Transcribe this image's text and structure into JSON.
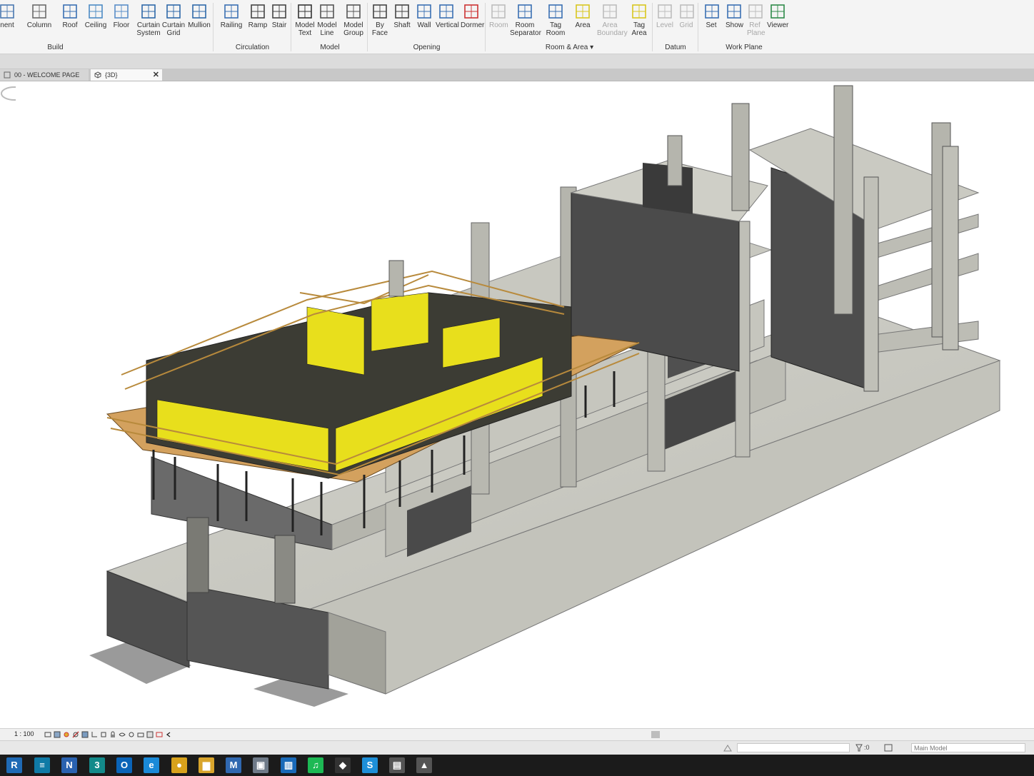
{
  "ribbon": {
    "tools": [
      {
        "id": "component",
        "label": "nent",
        "icon": "component-icon",
        "enabled": true
      },
      {
        "id": "column",
        "label": "Column",
        "icon": "column-icon",
        "enabled": true
      },
      {
        "id": "roof",
        "label": "Roof",
        "icon": "roof-icon",
        "enabled": true
      },
      {
        "id": "ceiling",
        "label": "Ceiling",
        "icon": "ceiling-icon",
        "enabled": true
      },
      {
        "id": "floor",
        "label": "Floor",
        "icon": "floor-icon",
        "enabled": true
      },
      {
        "id": "curtain-system",
        "label": "Curtain System",
        "icon": "curtain-system-icon",
        "enabled": true
      },
      {
        "id": "curtain-grid",
        "label": "Curtain Grid",
        "icon": "curtain-grid-icon",
        "enabled": true
      },
      {
        "id": "mullion",
        "label": "Mullion",
        "icon": "mullion-icon",
        "enabled": true
      },
      {
        "id": "railing",
        "label": "Railing",
        "icon": "railing-icon",
        "enabled": true
      },
      {
        "id": "ramp",
        "label": "Ramp",
        "icon": "ramp-icon",
        "enabled": true
      },
      {
        "id": "stair",
        "label": "Stair",
        "icon": "stair-icon",
        "enabled": true
      },
      {
        "id": "model-text",
        "label": "Model Text",
        "icon": "model-text-icon",
        "enabled": true
      },
      {
        "id": "model-line",
        "label": "Model Line",
        "icon": "model-line-icon",
        "enabled": true
      },
      {
        "id": "model-group",
        "label": "Model Group",
        "icon": "model-group-icon",
        "enabled": true
      },
      {
        "id": "by-face",
        "label": "By Face",
        "icon": "by-face-icon",
        "enabled": true
      },
      {
        "id": "shaft",
        "label": "Shaft",
        "icon": "shaft-icon",
        "enabled": true
      },
      {
        "id": "wall",
        "label": "Wall",
        "icon": "wall-opening-icon",
        "enabled": true
      },
      {
        "id": "vertical",
        "label": "Vertical",
        "icon": "vertical-opening-icon",
        "enabled": true
      },
      {
        "id": "dormer",
        "label": "Dormer",
        "icon": "dormer-icon",
        "enabled": true
      },
      {
        "id": "room",
        "label": "Room",
        "icon": "room-icon",
        "enabled": false
      },
      {
        "id": "room-separator",
        "label": "Room Separator",
        "icon": "room-separator-icon",
        "enabled": true
      },
      {
        "id": "tag-room",
        "label": "Tag Room",
        "icon": "tag-room-icon",
        "enabled": true
      },
      {
        "id": "area",
        "label": "Area",
        "icon": "area-icon",
        "enabled": true
      },
      {
        "id": "area-boundary",
        "label": "Area Boundary",
        "icon": "area-boundary-icon",
        "enabled": false
      },
      {
        "id": "tag-area",
        "label": "Tag Area",
        "icon": "tag-area-icon",
        "enabled": true
      },
      {
        "id": "level",
        "label": "Level",
        "icon": "level-icon",
        "enabled": false
      },
      {
        "id": "grid",
        "label": "Grid",
        "icon": "grid-icon",
        "enabled": false
      },
      {
        "id": "set",
        "label": "Set",
        "icon": "set-workplane-icon",
        "enabled": true
      },
      {
        "id": "show",
        "label": "Show",
        "icon": "show-workplane-icon",
        "enabled": true
      },
      {
        "id": "ref-plane",
        "label": "Ref Plane",
        "icon": "ref-plane-icon",
        "enabled": false
      },
      {
        "id": "viewer",
        "label": "Viewer",
        "icon": "viewer-icon",
        "enabled": true
      }
    ],
    "panels": [
      {
        "id": "build",
        "label": "Build"
      },
      {
        "id": "circulation",
        "label": "Circulation"
      },
      {
        "id": "model",
        "label": "Model"
      },
      {
        "id": "opening",
        "label": "Opening"
      },
      {
        "id": "room-area",
        "label": "Room & Area"
      },
      {
        "id": "datum",
        "label": "Datum"
      },
      {
        "id": "work-plane",
        "label": "Work Plane"
      }
    ]
  },
  "tabs": [
    {
      "label": "00 - WELCOME PAGE",
      "active": false
    },
    {
      "label": "{3D}",
      "active": true
    }
  ],
  "viewbar": {
    "scale": "1 : 100"
  },
  "statusbar": {
    "selection_count": ":0",
    "model_label": "Main Model"
  },
  "taskbar": {
    "apps": [
      {
        "id": "revit",
        "glyph": "R",
        "color": "#1f6ab5"
      },
      {
        "id": "navisworks",
        "glyph": "≡",
        "color": "#0f7aa6"
      },
      {
        "id": "autodesk-n",
        "glyph": "N",
        "color": "#2a62b0"
      },
      {
        "id": "3ds",
        "glyph": "3",
        "color": "#138a8a"
      },
      {
        "id": "outlook",
        "glyph": "O",
        "color": "#0a64b8"
      },
      {
        "id": "edge",
        "glyph": "e",
        "color": "#1a8ad8"
      },
      {
        "id": "chrome",
        "glyph": "●",
        "color": "#d8a21c"
      },
      {
        "id": "explorer",
        "glyph": "▆",
        "color": "#d9a52c"
      },
      {
        "id": "app-m",
        "glyph": "M",
        "color": "#3068b0"
      },
      {
        "id": "app-doc",
        "glyph": "▣",
        "color": "#6f7a88"
      },
      {
        "id": "trello",
        "glyph": "▥",
        "color": "#1a6ab8"
      },
      {
        "id": "spotify",
        "glyph": "♫",
        "color": "#1db954"
      },
      {
        "id": "app-hex",
        "glyph": "◆",
        "color": "#333"
      },
      {
        "id": "skype",
        "glyph": "S",
        "color": "#1e8fd8"
      },
      {
        "id": "clapper",
        "glyph": "▤",
        "color": "#555"
      },
      {
        "id": "photos",
        "glyph": "▲",
        "color": "#555"
      }
    ]
  }
}
